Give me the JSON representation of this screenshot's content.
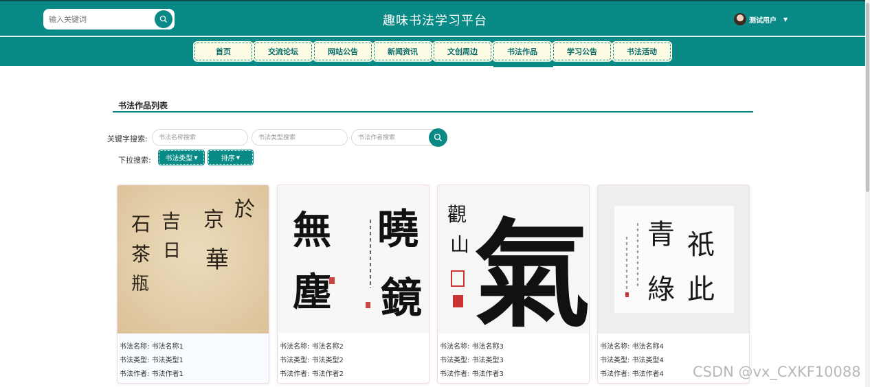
{
  "header": {
    "search_placeholder": "输入关键词",
    "site_title": "趣味书法学习平台",
    "user_name": "测试用户"
  },
  "nav": {
    "items": [
      "首页",
      "交流论坛",
      "网站公告",
      "新闻资讯",
      "文创周边",
      "书法作品",
      "学习公告",
      "书法活动"
    ],
    "active": "书法作品"
  },
  "section": {
    "title": "书法作品列表"
  },
  "filters": {
    "keyword_label": "关键字搜索:",
    "name_placeholder": "书法名称搜索",
    "type_placeholder": "书法类型搜索",
    "author_placeholder": "书法作者搜索",
    "dropdown_label": "下拉搜索:",
    "type_dropdown": "书法类型",
    "sort_dropdown": "排序"
  },
  "cards": [
    {
      "name_label": "书法名称:",
      "name": "书法名称1",
      "type_label": "书法类型:",
      "type": "书法类型1",
      "author_label": "书法作者:",
      "author": "书法作者1"
    },
    {
      "name_label": "书法名称:",
      "name": "书法名称2",
      "type_label": "书法类型:",
      "type": "书法类型2",
      "author_label": "书法作者:",
      "author": "书法作者2"
    },
    {
      "name_label": "书法名称:",
      "name": "书法名称3",
      "type_label": "书法类型:",
      "type": "书法类型3",
      "author_label": "书法作者:",
      "author": "书法作者3"
    },
    {
      "name_label": "书法名称:",
      "name": "书法名称4",
      "type_label": "书法类型:",
      "type": "书法类型4",
      "author_label": "书法作者:",
      "author": "书法作者4"
    }
  ],
  "artwork_characters": {
    "card1": [
      "於",
      "京",
      "華",
      "吉",
      "日",
      "石",
      "茶",
      "瓶"
    ],
    "card2": [
      "曉",
      "鏡",
      "無",
      "塵"
    ],
    "card3": [
      "氣",
      "觀",
      "山"
    ],
    "card4": [
      "祇",
      "此",
      "青",
      "綠"
    ]
  },
  "watermark": "CSDN @vx_CXKF10088",
  "colors": {
    "primary": "#0a8a86",
    "nav_bg": "#fdfbe4",
    "accent_border": "#f3d9e3"
  }
}
